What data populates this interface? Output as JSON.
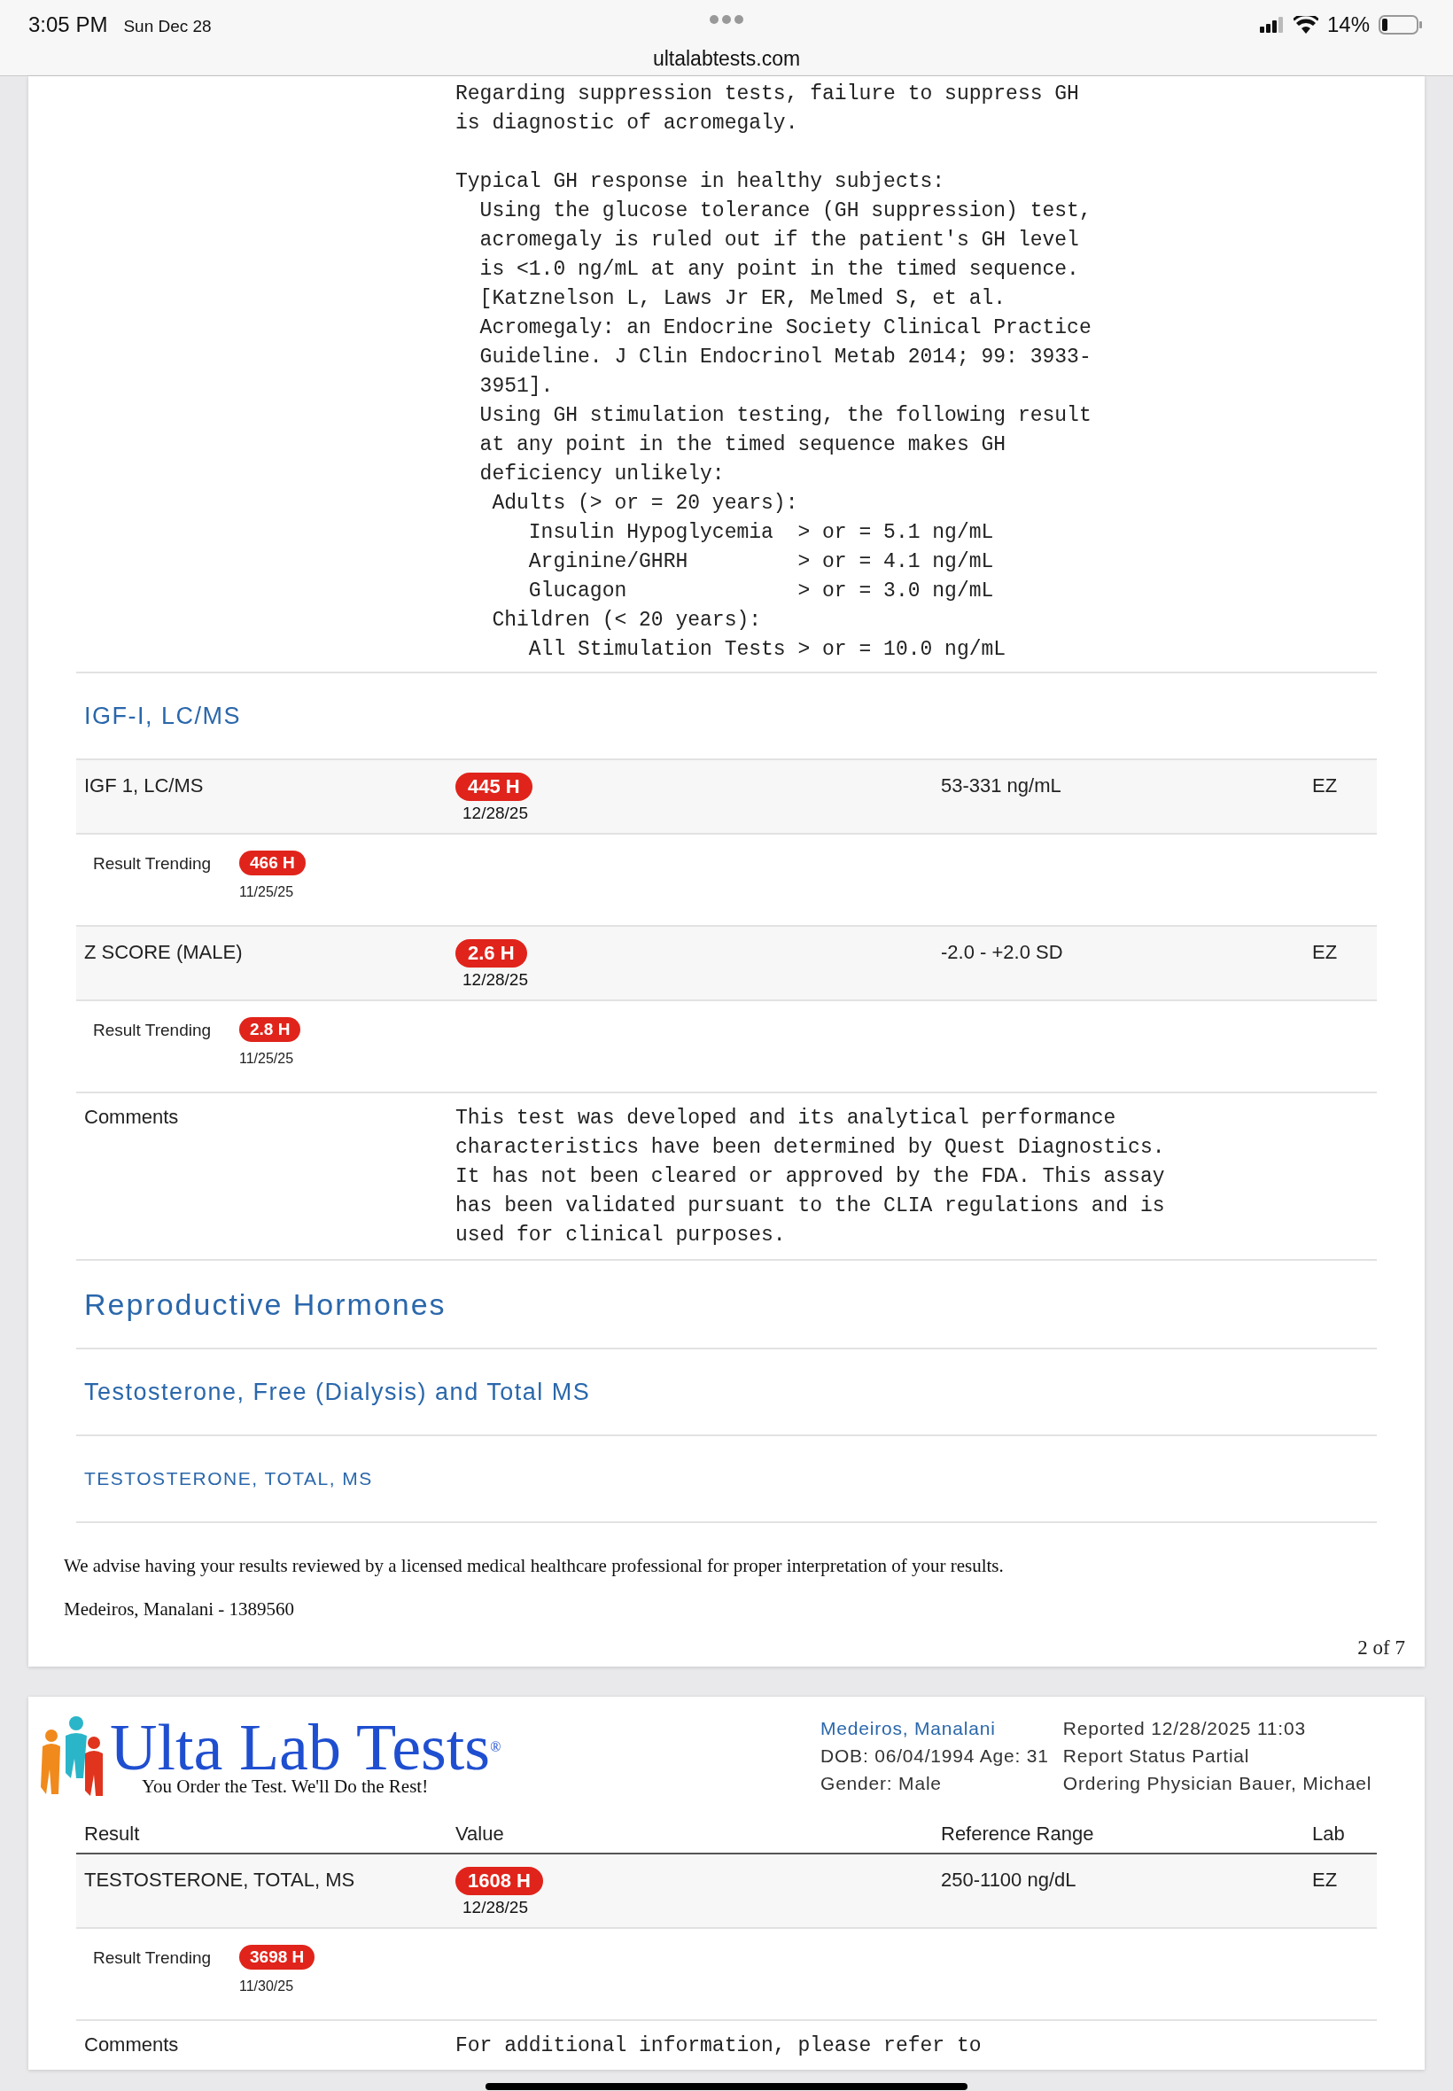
{
  "status_bar": {
    "time": "3:05 PM",
    "date": "Sun Dec 28",
    "battery": "14%"
  },
  "address_bar": {
    "url": "ultalabtests.com"
  },
  "page_1": {
    "note": [
      [
        "Regarding suppression tests, failure to suppress GH",
        "is diagnostic of acromegaly."
      ],
      [
        "Typical GH response in healthy subjects:",
        "  Using the glucose tolerance (GH suppression) test,",
        "  acromegaly is ruled out if the patient's GH level",
        "  is <1.0 ng/mL at any point in the timed sequence.",
        "  [Katznelson L, Laws Jr ER, Melmed S, et al.",
        "  Acromegaly: an Endocrine Society Clinical Practice",
        "  Guideline. J Clin Endocrinol Metab 2014; 99: 3933-",
        "  3951].",
        "  Using GH stimulation testing, the following result",
        "  at any point in the timed sequence makes GH",
        "  deficiency unlikely:",
        "   Adults (> or = 20 years):",
        "      Insulin Hypoglycemia  > or = 5.1 ng/mL",
        "      Arginine/GHRH         > or = 4.1 ng/mL",
        "      Glucagon              > or = 3.0 ng/mL",
        "   Children (< 20 years):",
        "      All Stimulation Tests > or = 10.0 ng/mL"
      ]
    ],
    "blocks": [
      {
        "kind": "panel_title",
        "text": "IGF-I, LC/MS"
      },
      {
        "kind": "result",
        "name": "IGF 1, LC/MS",
        "value": "445 H",
        "date": "12/28/25",
        "range": "53-331 ng/mL",
        "lab": "EZ"
      },
      {
        "kind": "trending",
        "label": "Result Trending",
        "value": "466 H",
        "date": "11/25/25"
      },
      {
        "kind": "result",
        "name": "Z SCORE (MALE)",
        "value": "2.6 H",
        "date": "12/28/25",
        "range": "-2.0 - +2.0 SD",
        "lab": "EZ"
      },
      {
        "kind": "trending",
        "label": "Result Trending",
        "value": "2.8 H",
        "date": "11/25/25"
      },
      {
        "kind": "comments",
        "label": "Comments",
        "lines": [
          "This test was developed and its analytical performance",
          "characteristics have been determined by Quest Diagnostics.",
          "It has not been cleared or approved by the FDA. This assay",
          "has been validated pursuant to the CLIA regulations and is",
          "used for clinical purposes."
        ]
      },
      {
        "kind": "section_title",
        "text": "Reproductive Hormones"
      },
      {
        "kind": "panel_title",
        "text": "Testosterone, Free (Dialysis) and Total MS"
      },
      {
        "kind": "test_title",
        "text": "TESTOSTERONE, TOTAL, MS"
      }
    ],
    "disclaimer": "We advise having your results reviewed by a licensed medical healthcare professional for proper interpretation of your results.",
    "patient_line": "Medeiros, Manalani - 1389560",
    "page_number": "2 of 7"
  },
  "page_2": {
    "logo": {
      "name": "Ulta Lab Tests",
      "mark": "®",
      "tagline": "You Order the Test. We'll Do the Rest!"
    },
    "patient": {
      "name": "Medeiros, Manalani",
      "dob": "DOB: 06/04/1994 Age: 31",
      "gender": "Gender: Male"
    },
    "report": [
      "Reported 12/28/2025 11:03",
      "Report Status Partial",
      "Ordering Physician Bauer, Michael"
    ],
    "columns": [
      "Result",
      "Value",
      "Reference Range",
      "Lab"
    ],
    "blocks": [
      {
        "kind": "result",
        "name": "TESTOSTERONE, TOTAL, MS",
        "value": "1608 H",
        "date": "12/28/25",
        "range": "250-1100 ng/dL",
        "lab": "EZ"
      },
      {
        "kind": "trending",
        "label": "Result Trending",
        "value": "3698 H",
        "date": "11/30/25"
      },
      {
        "kind": "comments",
        "label": "Comments",
        "lines": [
          "For additional information, please refer to"
        ]
      }
    ]
  }
}
